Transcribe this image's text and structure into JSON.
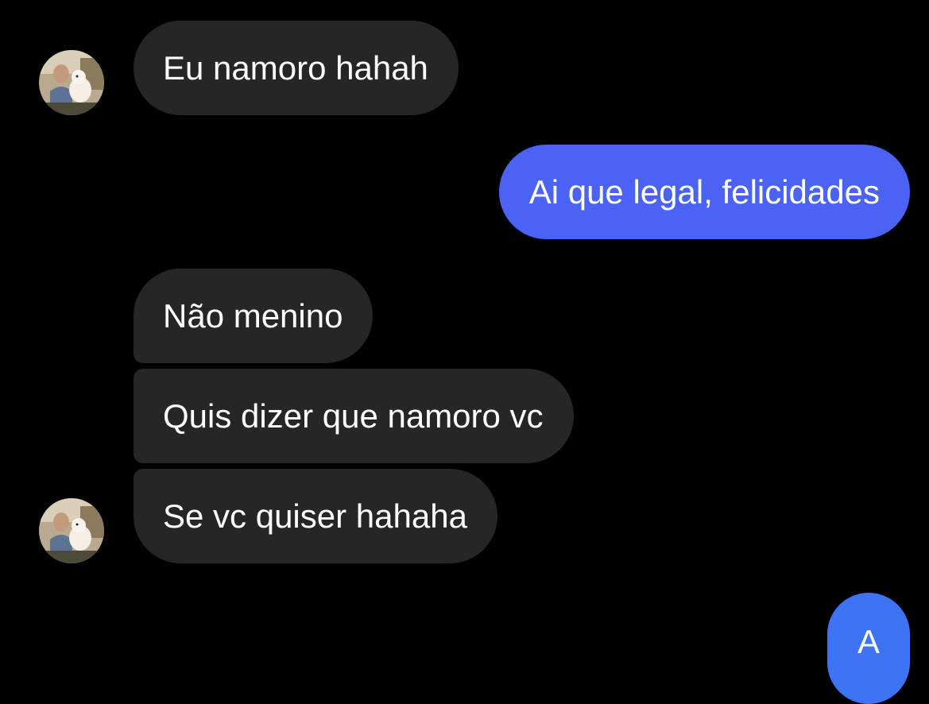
{
  "conversation": {
    "messages": [
      {
        "sender": "contact",
        "text": "Eu namoro hahah"
      },
      {
        "sender": "me",
        "text": "Ai que legal, felicidades"
      },
      {
        "sender": "contact",
        "text": "Não menino"
      },
      {
        "sender": "contact",
        "text": "Quis dizer que namoro vc"
      },
      {
        "sender": "contact",
        "text": "Se vc quiser hahaha"
      },
      {
        "sender": "me",
        "text": "A"
      }
    ]
  },
  "colors": {
    "background": "#000000",
    "incoming_bubble": "#262626",
    "outgoing_bubble": "#4a63f4",
    "text": "#ffffff"
  },
  "icons": {
    "contact_avatar": "contact-avatar-photo"
  }
}
